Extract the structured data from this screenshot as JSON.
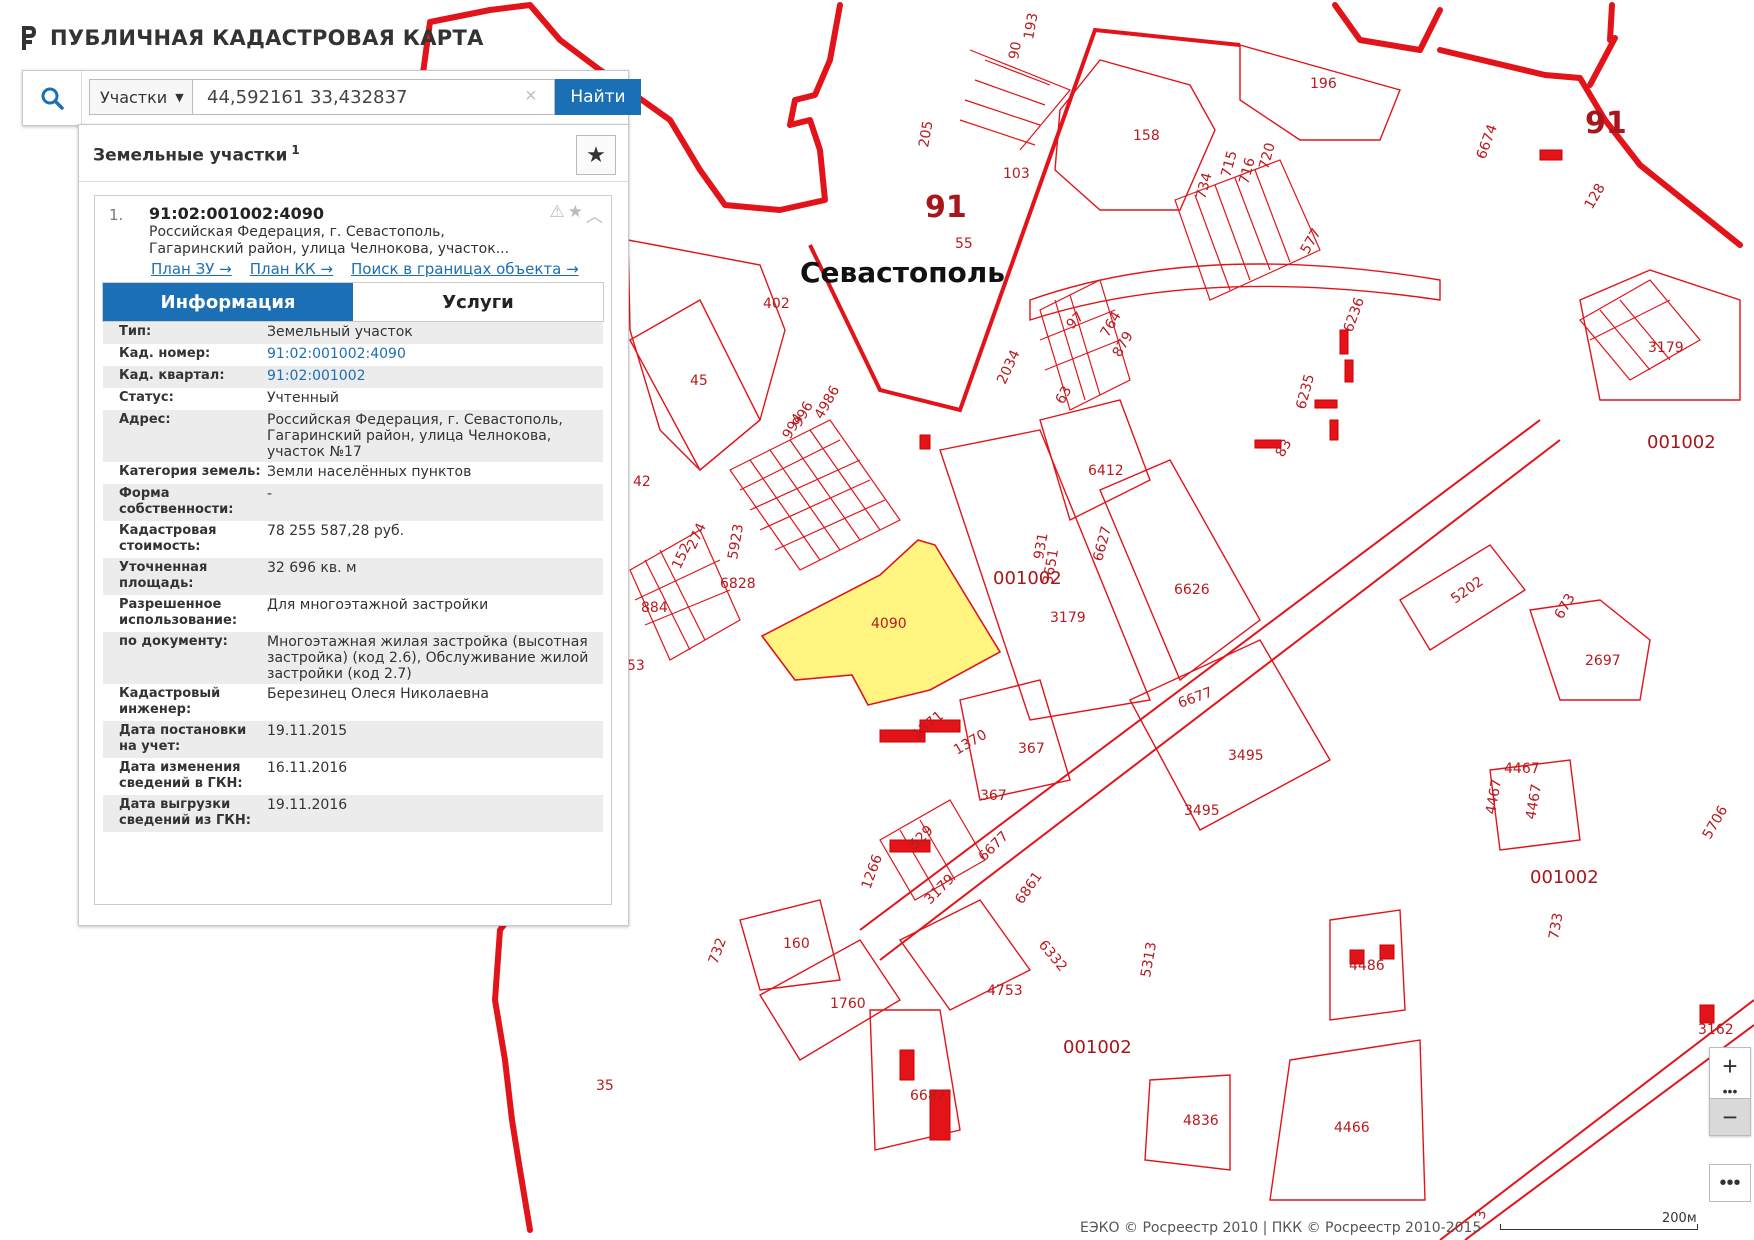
{
  "app": {
    "title": "ПУБЛИЧНАЯ КАДАСТРОВАЯ КАРТА"
  },
  "search": {
    "type_label": "Участки",
    "query": "44,592161 33,432837",
    "find_label": "Найти"
  },
  "panel": {
    "title": "Земельные участки",
    "count": "1"
  },
  "result": {
    "index": "1.",
    "cadastral_number": "91:02:001002:4090",
    "address_short": "Российская Федерация, г. Севастополь, Гагаринский район, улица Челнокова, участок...",
    "links": [
      "План ЗУ →",
      "План КК →",
      "Поиск в границах объекта →"
    ]
  },
  "tabs": {
    "info": "Информация",
    "services": "Услуги"
  },
  "details": [
    {
      "key": "Тип:",
      "value": "Земельный участок"
    },
    {
      "key": "Кад. номер:",
      "value": "91:02:001002:4090",
      "link": true
    },
    {
      "key": "Кад. квартал:",
      "value": "91:02:001002",
      "link": true
    },
    {
      "key": "Статус:",
      "value": "Учтенный"
    },
    {
      "key": "Адрес:",
      "value": "Российская Федерация, г. Севастополь, Гагаринский район, улица Челнокова, участок №17"
    },
    {
      "key": "Категория земель:",
      "value": "Земли населённых пунктов"
    },
    {
      "key": "Форма собственности:",
      "value": "-"
    },
    {
      "key": "Кадастровая стоимость:",
      "value": "78 255 587,28 руб."
    },
    {
      "key": "Уточненная площадь:",
      "value": "32 696 кв. м"
    },
    {
      "key": "Разрешенное использование:",
      "value": "Для многоэтажной застройки"
    },
    {
      "key": "по документу:",
      "value": "Многоэтажная жилая застройка (высотная застройка) (код 2.6), Обслуживание жилой застройки (код 2.7)"
    },
    {
      "key": "Кадастровый инженер:",
      "value": "Березинец Олеся Николаевна"
    },
    {
      "key": "Дата постановки на учет:",
      "value": "19.11.2015"
    },
    {
      "key": "Дата изменения сведений в ГКН:",
      "value": "16.11.2016"
    },
    {
      "key": "Дата выгрузки сведений из ГКН:",
      "value": "19.11.2016"
    }
  ],
  "map": {
    "city_label": "Севастополь",
    "region_labels": [
      "91",
      "91"
    ],
    "quarter_labels": [
      "001002",
      "001002",
      "001002",
      "001002",
      "001002"
    ],
    "parcel_labels": [
      "196",
      "158",
      "103",
      "55",
      "205",
      "90",
      "193",
      "6674",
      "128",
      "715",
      "720",
      "716",
      "734",
      "577",
      "402",
      "45",
      "42",
      "3179",
      "6236",
      "97",
      "764",
      "879",
      "2034",
      "63",
      "4986",
      "996",
      "994",
      "83",
      "6235",
      "6412",
      "6627",
      "6626",
      "5923",
      "931",
      "3651",
      "152",
      "274",
      "6828",
      "884",
      "53",
      "4090",
      "3179",
      "5202",
      "673",
      "2697",
      "6677",
      "1371",
      "1370",
      "367",
      "367",
      "3495",
      "3495",
      "4467",
      "4467",
      "4467",
      "529",
      "6677",
      "1266",
      "5706",
      "3179",
      "6861",
      "160",
      "732",
      "6332",
      "5313",
      "4486",
      "733",
      "1760",
      "4753",
      "3162",
      "35",
      "6687",
      "4836",
      "4466",
      "3"
    ],
    "selected_parcel": "4090",
    "highlight_color": "#fff580",
    "boundary_color": "#e2141a"
  },
  "controls": {
    "zoom_in": "+",
    "zoom_out": "−",
    "dots": "•••",
    "more": "•••"
  },
  "footer": {
    "attribution": "ЕЭКО © Росреестр 2010 | ПКК © Росреестр 2010-2015",
    "scale": "200м"
  }
}
